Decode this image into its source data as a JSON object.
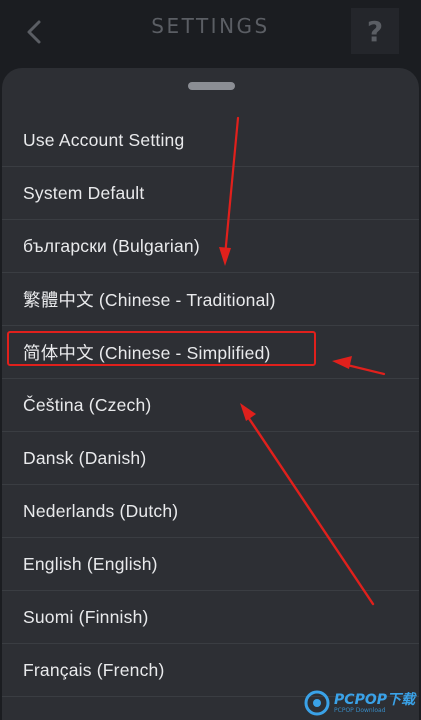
{
  "header": {
    "title": "SETTINGS",
    "help_label": "?"
  },
  "languages": [
    "Use Account Setting",
    "System Default",
    "български (Bulgarian)",
    "繁體中文 (Chinese - Traditional)",
    "简体中文 (Chinese - Simplified)",
    "Čeština (Czech)",
    "Dansk (Danish)",
    "Nederlands (Dutch)",
    "English (English)",
    "Suomi (Finnish)",
    "Français (French)"
  ],
  "highlighted_item": "简体中文 (Chinese - Simplified)",
  "watermark": {
    "brand": "PCPOP",
    "tag": "下载",
    "sub": "PCPOP Download"
  },
  "colors": {
    "background": "#1b1d21",
    "sheet": "#2d2f34",
    "annotation": "#e0201c",
    "watermark": "#3aa2e8"
  },
  "icons": {
    "back": "chevron-left-icon",
    "help": "question-mark-icon",
    "handle": "drag-handle-icon"
  }
}
